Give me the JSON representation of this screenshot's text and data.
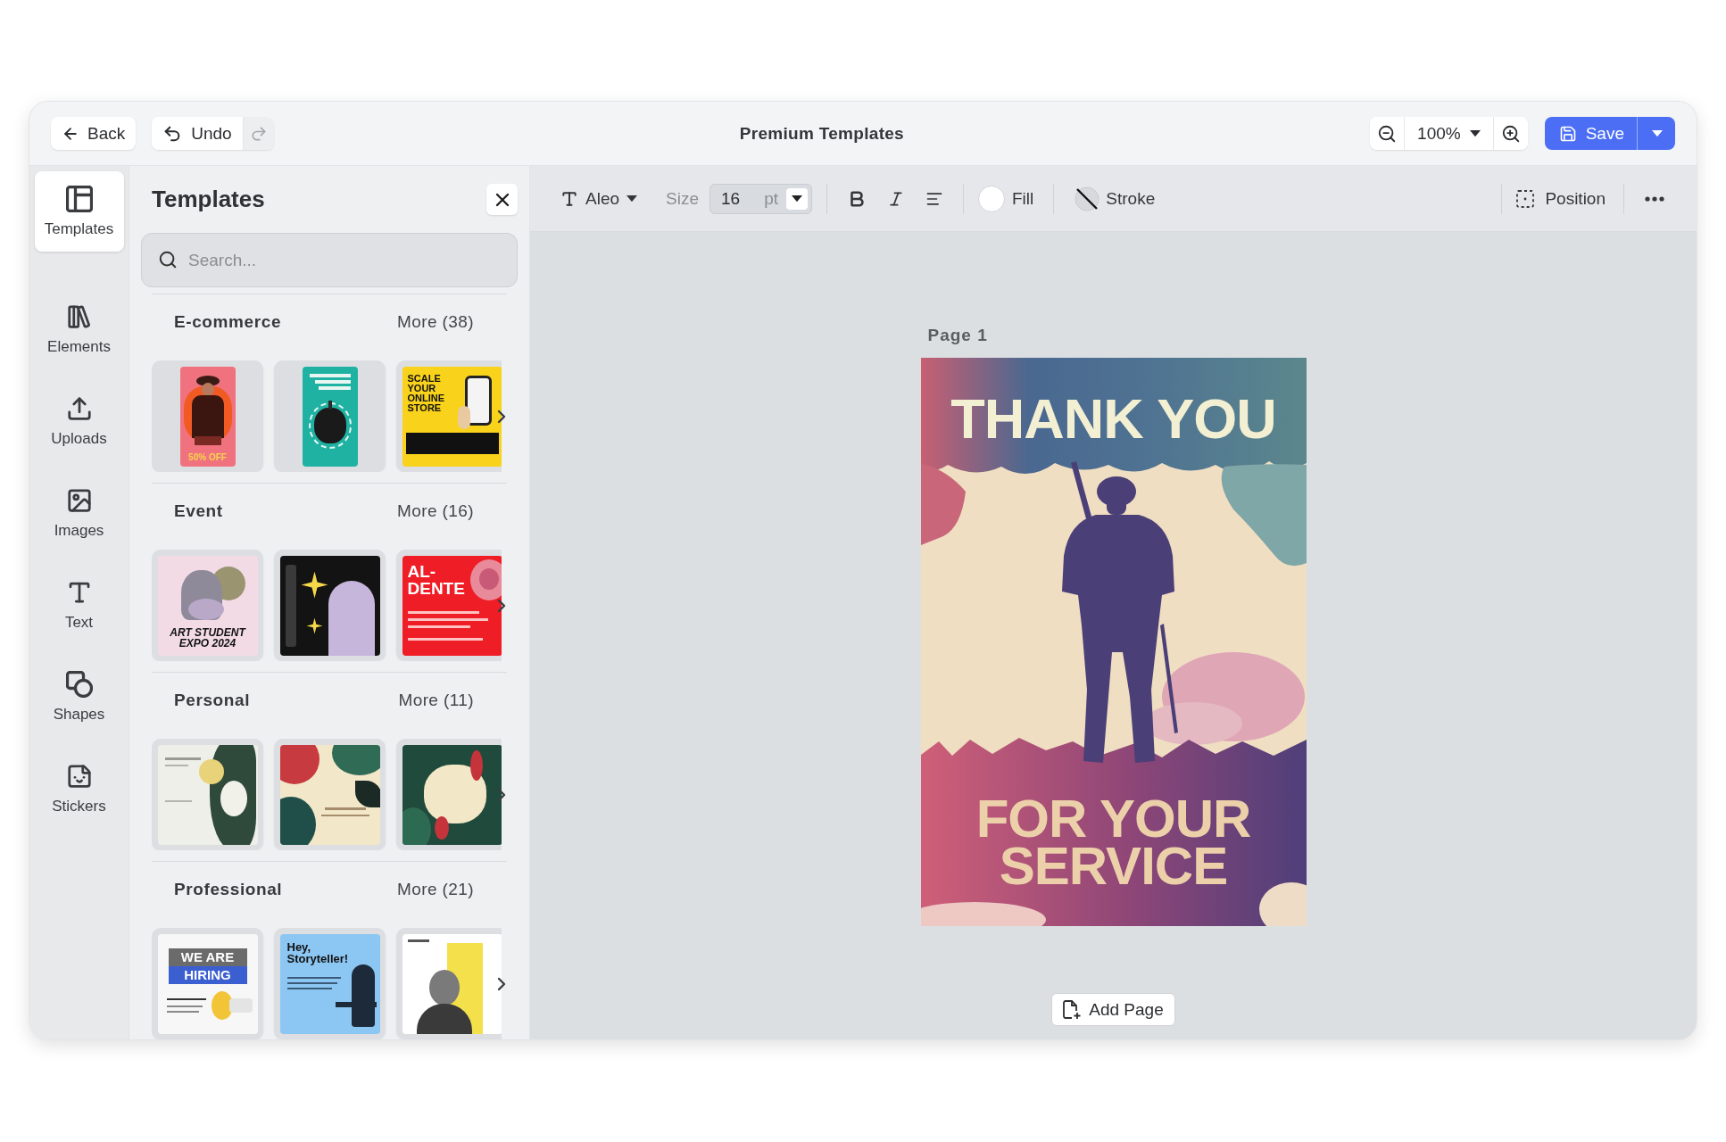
{
  "window": {
    "title": "Premium Templates"
  },
  "top_bar": {
    "back": "Back",
    "undo": "Undo",
    "redo": {
      "disabled": true
    },
    "zoom": "100%",
    "save": "Save"
  },
  "sidebar": {
    "items": [
      {
        "label": "Templates",
        "kind": "templates",
        "selected": true
      },
      {
        "label": "Elements",
        "kind": "elements",
        "selected": false
      },
      {
        "label": "Uploads",
        "kind": "uploads",
        "selected": false
      },
      {
        "label": "Images",
        "kind": "images",
        "selected": false
      },
      {
        "label": "Text",
        "kind": "text",
        "selected": false
      },
      {
        "label": "Shapes",
        "kind": "shapes",
        "selected": false
      },
      {
        "label": "Stickers",
        "kind": "stickers",
        "selected": false
      }
    ]
  },
  "panel": {
    "title": "Templates",
    "search": {
      "placeholder": "Search..."
    },
    "sections": [
      {
        "title": "E-commerce",
        "more": "More (38)",
        "thumbnails": [
          {
            "kind": "fashion",
            "headline": "50% OFF"
          },
          {
            "kind": "food"
          },
          {
            "kind": "store",
            "headline": "SCALE YOUR ONLINE STORE"
          }
        ]
      },
      {
        "title": "Event",
        "more": "More (16)",
        "thumbnails": [
          {
            "kind": "expo",
            "headline": "ART STUDENT EXPO 2024"
          },
          {
            "kind": "celebrate"
          },
          {
            "kind": "pasta",
            "headline": "AL-DENTE"
          }
        ]
      },
      {
        "title": "Personal",
        "more": "More (11)",
        "thumbnails": [
          {
            "kind": "ink"
          },
          {
            "kind": "leaves"
          },
          {
            "kind": "koi"
          }
        ]
      },
      {
        "title": "Professional",
        "more": "More (21)",
        "thumbnails": [
          {
            "kind": "hiring",
            "headline": "WE ARE HIRING"
          },
          {
            "kind": "story",
            "headline": "Hey, Storyteller!"
          },
          {
            "kind": "portrait"
          }
        ]
      }
    ]
  },
  "toolbar": {
    "font": "Aleo",
    "size_label": "Size",
    "size": {
      "value": "16",
      "unit": "pt"
    },
    "fill": {
      "label": "Fill",
      "color": "#ffffff"
    },
    "stroke": {
      "label": "Stroke"
    },
    "position": "Position"
  },
  "canvas": {
    "page_label": "Page 1",
    "poster": {
      "title": "THANK YOU",
      "subtitle": "FOR YOUR SERVICE"
    },
    "add_page": "Add Page"
  }
}
